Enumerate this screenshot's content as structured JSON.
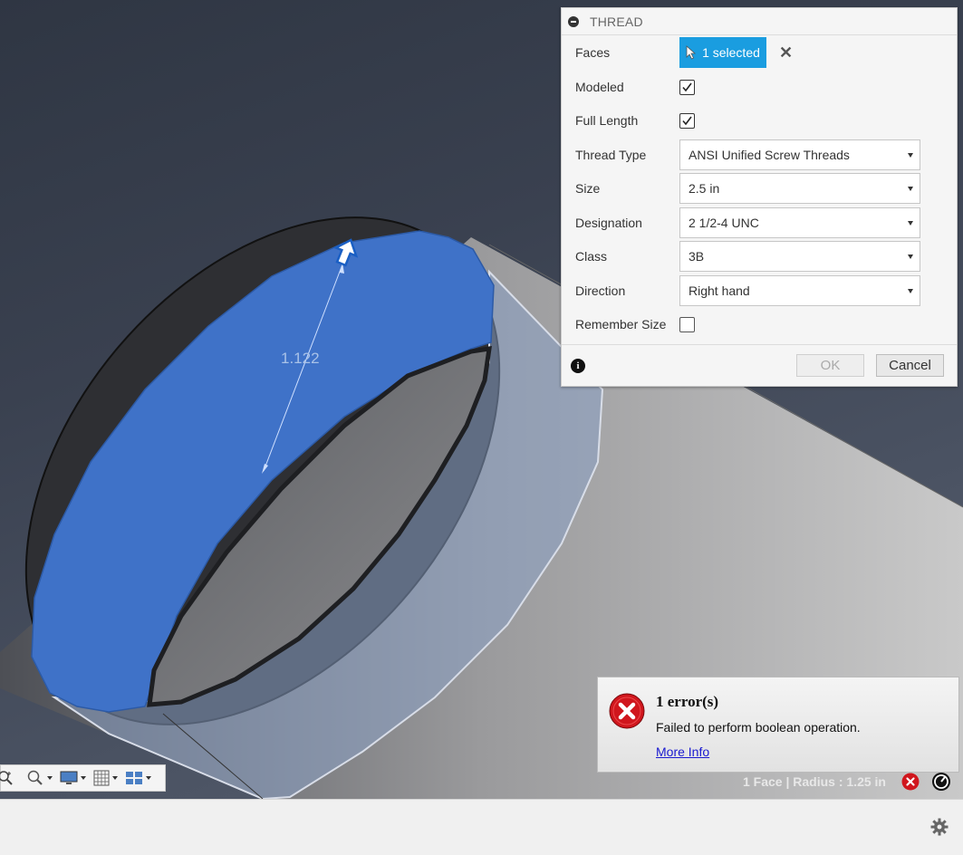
{
  "viewport": {
    "dimension_value": "1.122",
    "status_text": "1 Face | Radius : 1.25 in"
  },
  "dialog": {
    "title": "THREAD",
    "rows": {
      "faces": {
        "label": "Faces",
        "value": "1 selected"
      },
      "modeled": {
        "label": "Modeled",
        "checked": true
      },
      "full_length": {
        "label": "Full Length",
        "checked": true
      },
      "thread_type": {
        "label": "Thread Type",
        "value": "ANSI Unified Screw Threads"
      },
      "size": {
        "label": "Size",
        "value": "2.5 in"
      },
      "designation": {
        "label": "Designation",
        "value": "2 1/2-4 UNC"
      },
      "class": {
        "label": "Class",
        "value": "3B"
      },
      "direction": {
        "label": "Direction",
        "value": "Right hand"
      },
      "remember_size": {
        "label": "Remember Size",
        "checked": false
      }
    },
    "ok_label": "OK",
    "cancel_label": "Cancel"
  },
  "toast": {
    "title": "1 error(s)",
    "message": "Failed to perform boolean operation.",
    "link": "More Info"
  },
  "colors": {
    "selection_blue": "#1a9de0",
    "face_highlight": "#3f72c8",
    "error_red": "#d0161d"
  }
}
